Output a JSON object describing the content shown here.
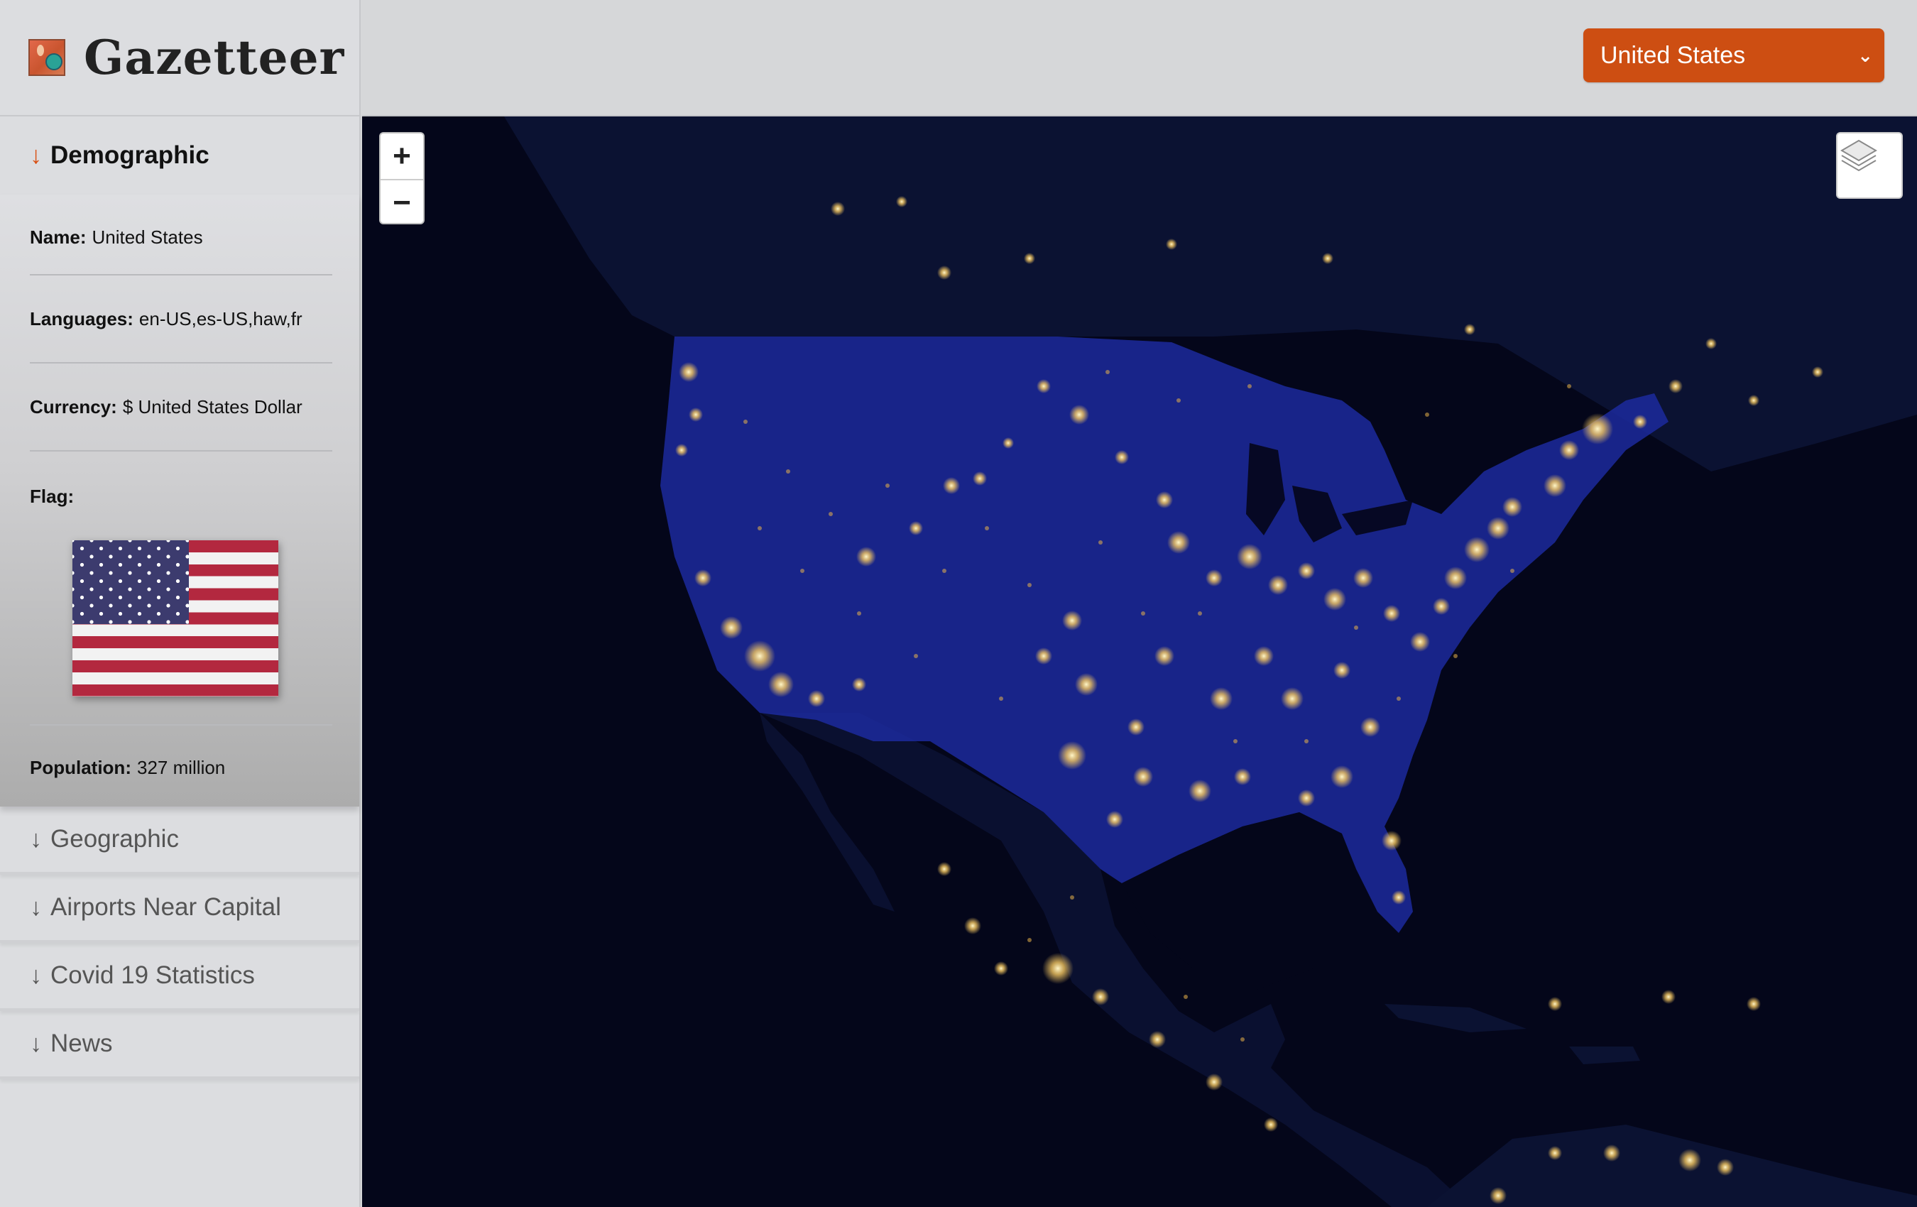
{
  "app": {
    "title": "Gazetteer",
    "logo_icon": "map-globe-icon"
  },
  "country_select": {
    "selected": "United States",
    "chevron_icon": "chevron-down-icon",
    "accent": "#cd4e12"
  },
  "sidebar": {
    "arrow_glyph": "↓",
    "sections": [
      {
        "label": "Demographic",
        "expanded": true
      },
      {
        "label": "Geographic",
        "expanded": false
      },
      {
        "label": "Airports Near Capital",
        "expanded": false
      },
      {
        "label": "Covid 19 Statistics",
        "expanded": false
      },
      {
        "label": "News",
        "expanded": false
      }
    ],
    "demographic": {
      "name_label": "Name:",
      "name_value": "United States",
      "languages_label": "Languages:",
      "languages_value": "en-US,es-US,haw,fr",
      "currency_label": "Currency:",
      "currency_value": "$ United States Dollar",
      "flag_label": "Flag:",
      "flag_icon": "us-flag-image",
      "population_label": "Population:",
      "population_value": "327 million"
    }
  },
  "map": {
    "zoom_in": "+",
    "zoom_out": "−",
    "layers_icon": "layers-icon",
    "basemap": "night-lights",
    "highlight_color": "#1c2a9e"
  }
}
